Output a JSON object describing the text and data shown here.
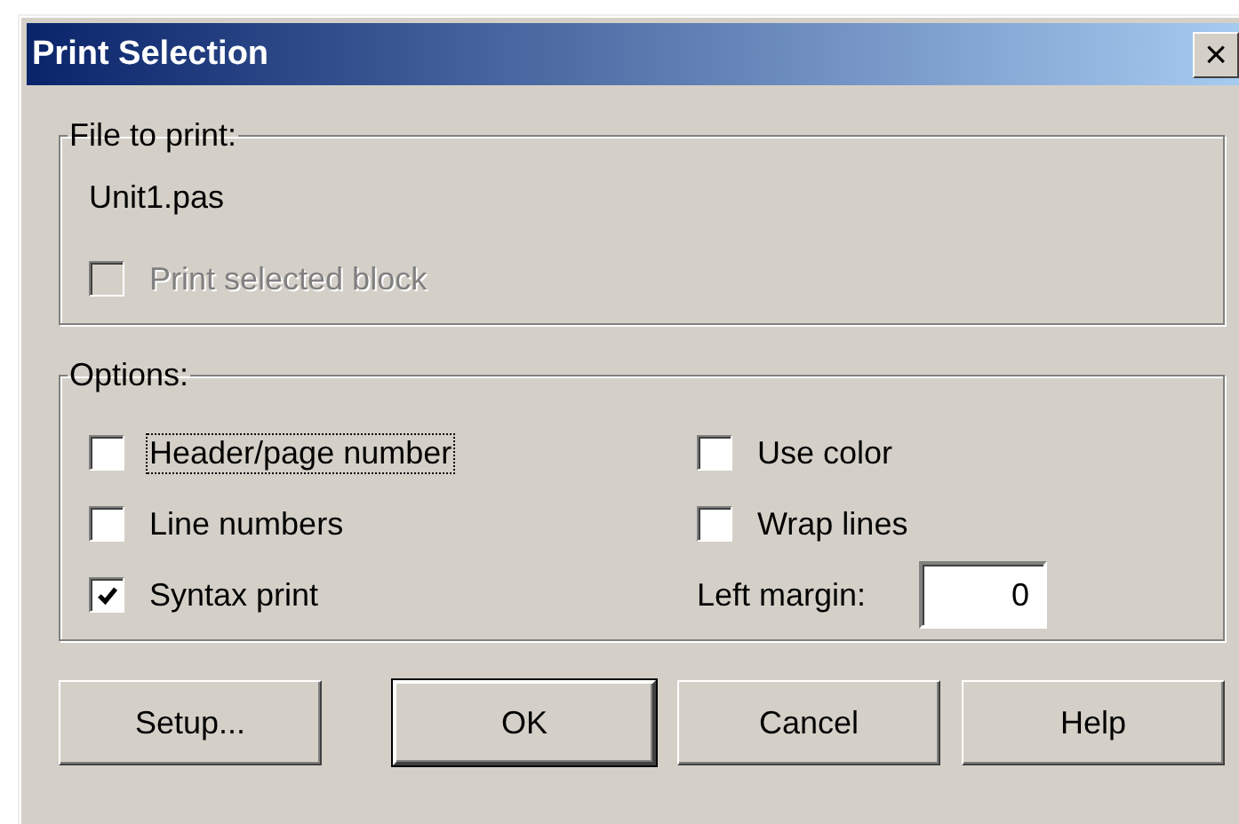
{
  "window": {
    "title": "Print Selection",
    "close": "×"
  },
  "file_group": {
    "label": "File to print:",
    "file": "Unit1.pas",
    "option": {
      "label": "Print selected block",
      "checked": false,
      "disabled": true
    }
  },
  "options_group": {
    "label": "Options:",
    "left": [
      {
        "label": "Header/page number",
        "checked": false,
        "focused": true
      },
      {
        "label": "Line numbers",
        "checked": false,
        "focused": false
      },
      {
        "label": "Syntax print",
        "checked": true,
        "focused": false
      }
    ],
    "right": [
      {
        "label": "Use color",
        "checked": false,
        "focused": false
      },
      {
        "label": "Wrap lines",
        "checked": false,
        "focused": false
      }
    ],
    "margin": {
      "label": "Left margin:",
      "value": "0"
    }
  },
  "buttons": [
    {
      "label": "Setup...",
      "default": false
    },
    {
      "label": "OK",
      "default": true
    },
    {
      "label": "Cancel",
      "default": false
    },
    {
      "label": "Help",
      "default": false
    }
  ]
}
